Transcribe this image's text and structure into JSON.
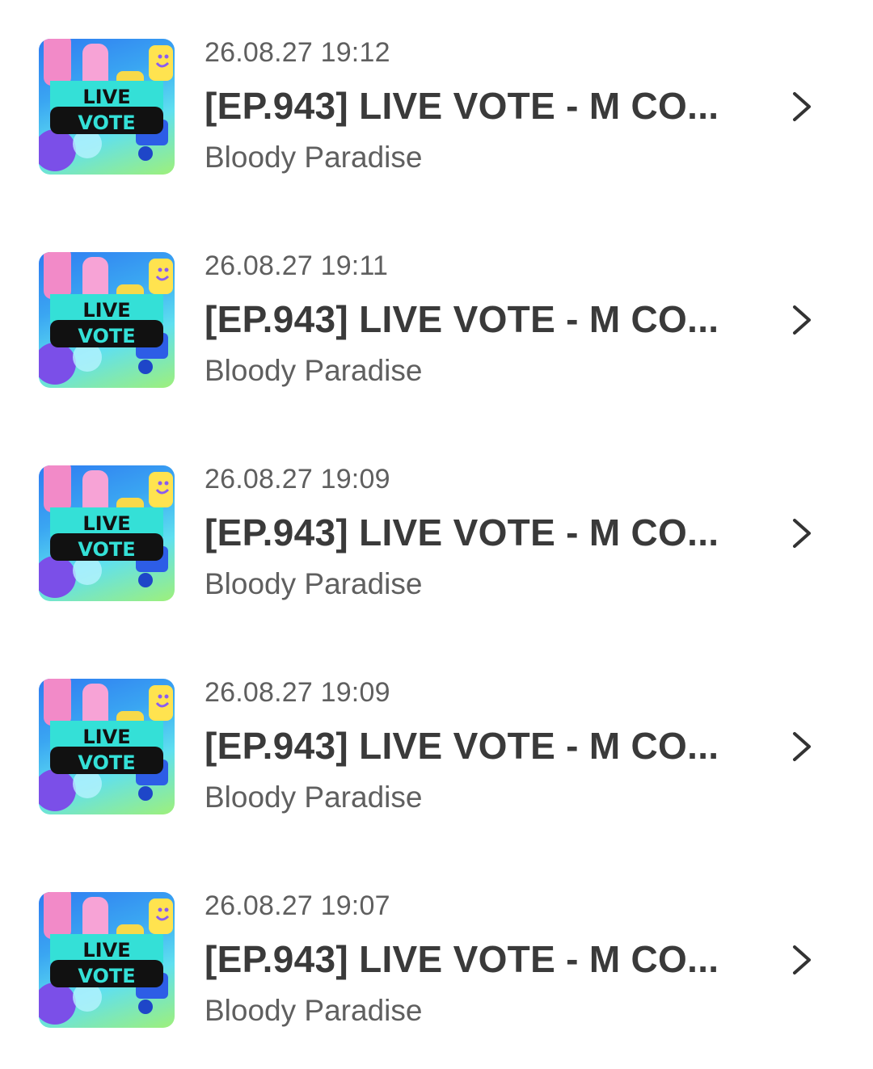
{
  "colors": {
    "title": "#3a3a3a",
    "meta": "#5f5f5f",
    "background": "#ffffff"
  },
  "thumbnail": {
    "line1": "LIVE",
    "line2": "VOTE",
    "icon": "live-vote-thumbnail"
  },
  "items": [
    {
      "date": "26.08.27 19:12",
      "title": "[EP.943] LIVE VOTE - M CO...",
      "subtitle": "Bloody Paradise"
    },
    {
      "date": "26.08.27 19:11",
      "title": "[EP.943] LIVE VOTE - M CO...",
      "subtitle": "Bloody Paradise"
    },
    {
      "date": "26.08.27 19:09",
      "title": "[EP.943] LIVE VOTE - M CO...",
      "subtitle": "Bloody Paradise"
    },
    {
      "date": "26.08.27 19:09",
      "title": "[EP.943] LIVE VOTE - M CO...",
      "subtitle": "Bloody Paradise"
    },
    {
      "date": "26.08.27 19:07",
      "title": "[EP.943] LIVE VOTE - M CO...",
      "subtitle": "Bloody Paradise"
    }
  ]
}
